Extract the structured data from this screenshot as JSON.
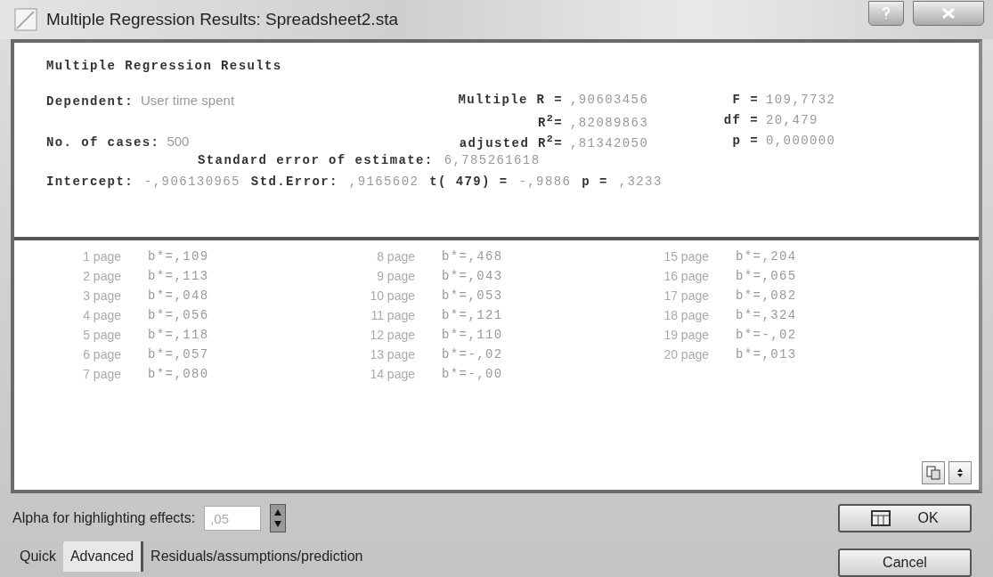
{
  "window": {
    "title": "Multiple Regression Results: Spreadsheet2.sta"
  },
  "results": {
    "heading": "Multiple Regression Results",
    "left_stats": [
      {
        "label": "Dependent:",
        "value": "User time spent"
      },
      {
        "label": "No. of cases:",
        "value": "500"
      }
    ],
    "middle_stats": [
      {
        "label": "Multiple R =",
        "value": ",90603456"
      },
      {
        "label": "R$^{2}$=",
        "value": ",82089863"
      },
      {
        "label": "adjusted R$^{2}$=",
        "value": ",81342050"
      }
    ],
    "right_stats": [
      {
        "label": "F =",
        "value": "109,7732"
      },
      {
        "label": "df =",
        "value": "20,479"
      },
      {
        "label": "p =",
        "value": "0,000000"
      }
    ],
    "std_error": {
      "label": "Standard error of estimate:",
      "value": "6,785261618"
    },
    "intercept": [
      {
        "label": "Intercept:",
        "value": "-,906130965"
      },
      {
        "label": "Std.Error:",
        "value": ",9165602"
      },
      {
        "label": "t(  479) =",
        "value": "-,9886"
      },
      {
        "label": "p =",
        "value": ",3233"
      }
    ],
    "coefficients": [
      {
        "label": "1 page",
        "value": "b*=,109"
      },
      {
        "label": "2 page",
        "value": "b*=,113"
      },
      {
        "label": "3 page",
        "value": "b*=,048"
      },
      {
        "label": "4 page",
        "value": "b*=,056"
      },
      {
        "label": "5 page",
        "value": "b*=,118"
      },
      {
        "label": "6 page",
        "value": "b*=,057"
      },
      {
        "label": "7 page",
        "value": "b*=,080"
      },
      {
        "label": "8 page",
        "value": "b*=,468"
      },
      {
        "label": "9 page",
        "value": "b*=,043"
      },
      {
        "label": "10 page",
        "value": "b*=,053"
      },
      {
        "label": "11 page",
        "value": "b*=,121"
      },
      {
        "label": "12 page",
        "value": "b*=,110"
      },
      {
        "label": "13 page",
        "value": "b*=-,02"
      },
      {
        "label": "14 page",
        "value": "b*=-,00"
      },
      {
        "label": "15 page",
        "value": "b*=,204"
      },
      {
        "label": "16 page",
        "value": "b*=,065"
      },
      {
        "label": "17 page",
        "value": "b*=,082"
      },
      {
        "label": "18 page",
        "value": "b*=,324"
      },
      {
        "label": "19 page",
        "value": "b*=-,02"
      },
      {
        "label": "20 page",
        "value": "b*=,013"
      }
    ]
  },
  "alpha": {
    "label": "Alpha for highlighting effects:",
    "value": ",05"
  },
  "tabs": [
    {
      "label": "Quick",
      "selected": false
    },
    {
      "label": "Advanced",
      "selected": true
    },
    {
      "label": "Residuals/assumptions/prediction",
      "selected": false
    }
  ],
  "buttons": [
    {
      "kind": "ok",
      "label": "OK"
    },
    {
      "kind": "cancel",
      "label": "Cancel"
    }
  ]
}
